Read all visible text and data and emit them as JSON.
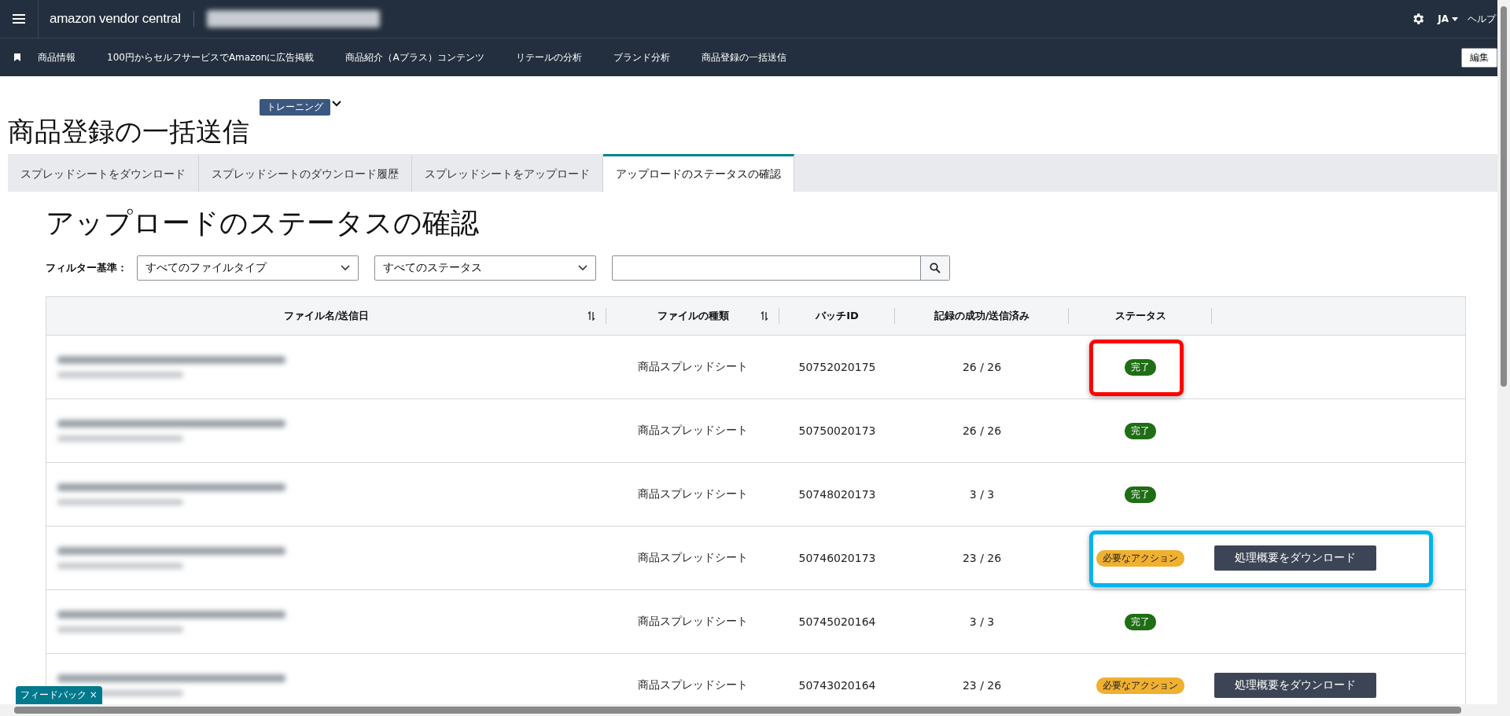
{
  "top_bar": {
    "logo": "amazon vendor central",
    "language": "JA",
    "help": "ヘルプ"
  },
  "nav": {
    "items": [
      "商品情報",
      "100円からセルフサービスでAmazonに広告掲載",
      "商品紹介（Aプラス）コンテンツ",
      "リテールの分析",
      "ブランド分析",
      "商品登録の一括送信"
    ],
    "edit": "編集"
  },
  "page": {
    "badge": "トレーニング",
    "title": "商品登録の一括送信"
  },
  "tabs": [
    {
      "label": "スプレッドシートをダウンロード",
      "selected": false
    },
    {
      "label": "スプレッドシートのダウンロード履歴",
      "selected": false
    },
    {
      "label": "スプレッドシートをアップロード",
      "selected": false
    },
    {
      "label": "アップロードのステータスの確認",
      "selected": true
    }
  ],
  "section": {
    "heading": "アップロードのステータスの確認",
    "filter_label": "フィルター基準：",
    "file_type": "すべてのファイルタイプ",
    "status": "すべてのステータス"
  },
  "table": {
    "columns": [
      {
        "label": "ファイル名/送信日",
        "sortable": true
      },
      {
        "label": "ファイルの種類",
        "sortable": true
      },
      {
        "label": "バッチID",
        "sortable": false
      },
      {
        "label": "記録の成功/送信済み",
        "sortable": false
      },
      {
        "label": "ステータス",
        "sortable": false
      }
    ],
    "rows": [
      {
        "type": "商品スプレッドシート",
        "batch_id": "50752020175",
        "records": "26 / 26",
        "kind": "done",
        "status": "完了",
        "color": "#ff0000"
      },
      {
        "type": "商品スプレッドシート",
        "batch_id": "50750020173",
        "records": "26 / 26",
        "kind": "done",
        "status": "完了"
      },
      {
        "type": "商品スプレッドシート",
        "batch_id": "50748020173",
        "records": "3 / 3",
        "kind": "done",
        "status": "完了"
      },
      {
        "type": "商品スプレッドシート",
        "batch_id": "50746020173",
        "records": "23 / 26",
        "kind": "action",
        "status": "必要なアクション",
        "action": "処理概要をダウンロード",
        "color": "#00b4f0"
      },
      {
        "type": "商品スプレッドシート",
        "batch_id": "50745020164",
        "records": "3 / 3",
        "kind": "done",
        "status": "完了"
      },
      {
        "type": "商品スプレッドシート",
        "batch_id": "50743020164",
        "records": "23 / 26",
        "kind": "action",
        "status": "必要なアクション",
        "action": "処理概要をダウンロード"
      }
    ]
  },
  "feedback": "フィードバック ×"
}
